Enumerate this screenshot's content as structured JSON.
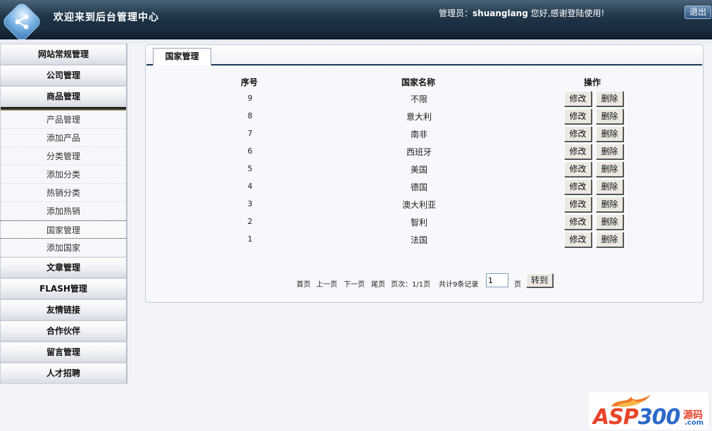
{
  "header": {
    "title": "欢迎来到后台管理中心",
    "admin_label": "管理员：",
    "admin_name": "shuanglang",
    "greeting": " 您好,感谢登陆使用!",
    "logout_label": "退出"
  },
  "sidebar": {
    "sections_top": [
      "网站常规管理",
      "公司管理",
      "商品管理"
    ],
    "submenu": [
      "产品管理",
      "添加产品",
      "分类管理",
      "添加分类",
      "热销分类",
      "添加热销",
      "国家管理",
      "添加国家"
    ],
    "active_item": "国家管理",
    "sections_bottom": [
      "文章管理",
      "FLASH管理",
      "友情链接",
      "合作伙伴",
      "留言管理",
      "人才招聘"
    ]
  },
  "main": {
    "tab_label": "国家管理",
    "columns": [
      "序号",
      "国家名称",
      "操作"
    ],
    "rows": [
      {
        "id": "9",
        "name": "不限"
      },
      {
        "id": "8",
        "name": "意大利"
      },
      {
        "id": "7",
        "name": "南非"
      },
      {
        "id": "6",
        "name": "西班牙"
      },
      {
        "id": "5",
        "name": "美国"
      },
      {
        "id": "4",
        "name": "德国"
      },
      {
        "id": "3",
        "name": "澳大利亚"
      },
      {
        "id": "2",
        "name": "智利"
      },
      {
        "id": "1",
        "name": "法国"
      }
    ],
    "edit_label": "修改",
    "delete_label": "删除",
    "pager": {
      "first": "首页",
      "prev": "上一页",
      "next": "下一页",
      "last": "尾页",
      "page_info": "页次：1/1页",
      "total": "共计9条记录",
      "page_value": "1",
      "page_suffix": "页",
      "go_label": "转到"
    }
  },
  "watermark": {
    "brand_a": "ASP",
    "brand_b": "300",
    "code": "源码",
    "domain": ".com"
  },
  "colors": {
    "header_dark": "#0c1e2e",
    "header_light": "#4a6378",
    "accent_line": "#1b3a55",
    "page_bg": "#f3f4f8"
  }
}
